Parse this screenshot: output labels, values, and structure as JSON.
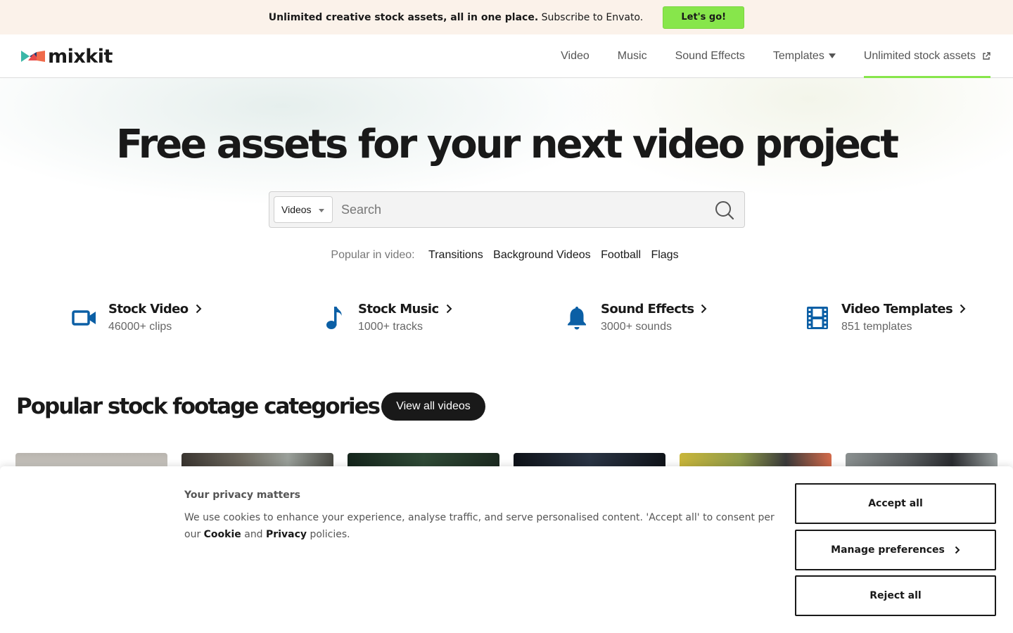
{
  "promo": {
    "text_bold": "Unlimited creative stock assets, all in one place.",
    "text_rest": "Subscribe to Envato.",
    "button": "Let's go!"
  },
  "header": {
    "logo": "mixkit",
    "nav": [
      "Video",
      "Music",
      "Sound Effects",
      "Templates",
      "Unlimited stock assets"
    ]
  },
  "hero": {
    "title": "Free assets for your next video project",
    "search": {
      "select_value": "Videos",
      "placeholder": "Search"
    },
    "popular_label": "Popular in video:",
    "popular_tags": [
      "Transitions",
      "Background Videos",
      "Football",
      "Flags"
    ]
  },
  "assets": [
    {
      "title": "Stock Video",
      "sub": "46000+ clips",
      "icon": "video-camera-icon"
    },
    {
      "title": "Stock Music",
      "sub": "1000+ tracks",
      "icon": "music-note-icon"
    },
    {
      "title": "Sound Effects",
      "sub": "3000+ sounds",
      "icon": "bell-icon"
    },
    {
      "title": "Video Templates",
      "sub": "851 templates",
      "icon": "film-strip-icon"
    }
  ],
  "categories": {
    "title": "Popular stock footage categories",
    "view_all": "View all videos"
  },
  "cookie": {
    "title": "Your privacy matters",
    "text_start": "We use cookies to enhance your experience, analyse traffic, and serve personalised content. 'Accept all' to consent per our",
    "cookie_link": "Cookie",
    "and": "and",
    "privacy_link": "Privacy",
    "text_end": "policies.",
    "accept": "Accept all",
    "manage": "Manage preferences",
    "reject": "Reject all"
  },
  "colors": {
    "accent_green": "#87e64b",
    "icon_blue": "#0b5fa5",
    "promo_bg": "#fbf2ea"
  }
}
